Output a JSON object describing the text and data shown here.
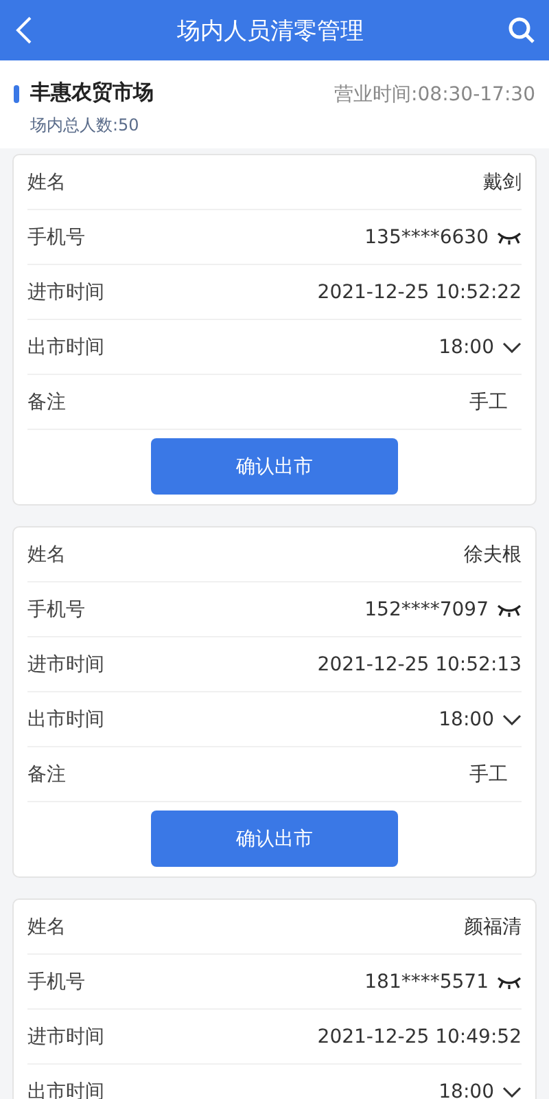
{
  "header": {
    "title": "场内人员清零管理"
  },
  "market": {
    "name": "丰惠农贸市场",
    "hours": "营业时间:08:30-17:30",
    "total": "场内总人数:50"
  },
  "cards": [
    {
      "rows": [
        {
          "kind": "text",
          "label": "姓名",
          "value": "戴剑"
        },
        {
          "kind": "phone",
          "label": "手机号",
          "value": "135****6630"
        },
        {
          "kind": "text",
          "label": "进市时间",
          "value": "2021-12-25 10:52:22"
        },
        {
          "kind": "select",
          "label": "出市时间",
          "value": "18:00"
        },
        {
          "kind": "note",
          "label": "备注",
          "value": "手工"
        }
      ],
      "button": "确认出市"
    },
    {
      "rows": [
        {
          "kind": "text",
          "label": "姓名",
          "value": "徐夫根"
        },
        {
          "kind": "phone",
          "label": "手机号",
          "value": "152****7097"
        },
        {
          "kind": "text",
          "label": "进市时间",
          "value": "2021-12-25 10:52:13"
        },
        {
          "kind": "select",
          "label": "出市时间",
          "value": "18:00"
        },
        {
          "kind": "note",
          "label": "备注",
          "value": "手工"
        }
      ],
      "button": "确认出市"
    },
    {
      "rows": [
        {
          "kind": "text",
          "label": "姓名",
          "value": "颜福清"
        },
        {
          "kind": "phone",
          "label": "手机号",
          "value": "181****5571"
        },
        {
          "kind": "text",
          "label": "进市时间",
          "value": "2021-12-25 10:49:52"
        },
        {
          "kind": "select",
          "label": "出市时间",
          "value": "18:00"
        }
      ]
    }
  ]
}
